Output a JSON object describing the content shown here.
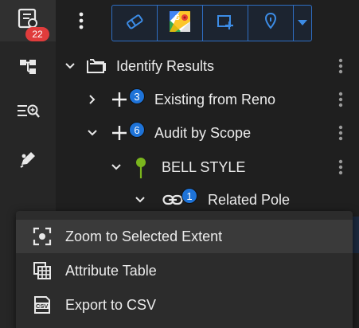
{
  "rail": {
    "notifications_count": "22"
  },
  "tree": {
    "root_label": "Identify Results",
    "items": [
      {
        "label": "Existing from Reno",
        "count": "3"
      },
      {
        "label": "Audit by Scope",
        "count": "6"
      },
      {
        "label": "BELL STYLE"
      },
      {
        "label": "Related Pole",
        "count": "1"
      }
    ]
  },
  "menu": {
    "items": [
      {
        "label": "Zoom to Selected Extent"
      },
      {
        "label": "Attribute Table"
      },
      {
        "label": "Export to CSV"
      }
    ]
  },
  "colors": {
    "accent": "#1e73d8",
    "badge": "#e03c3c",
    "pin": "#7ab51d"
  }
}
